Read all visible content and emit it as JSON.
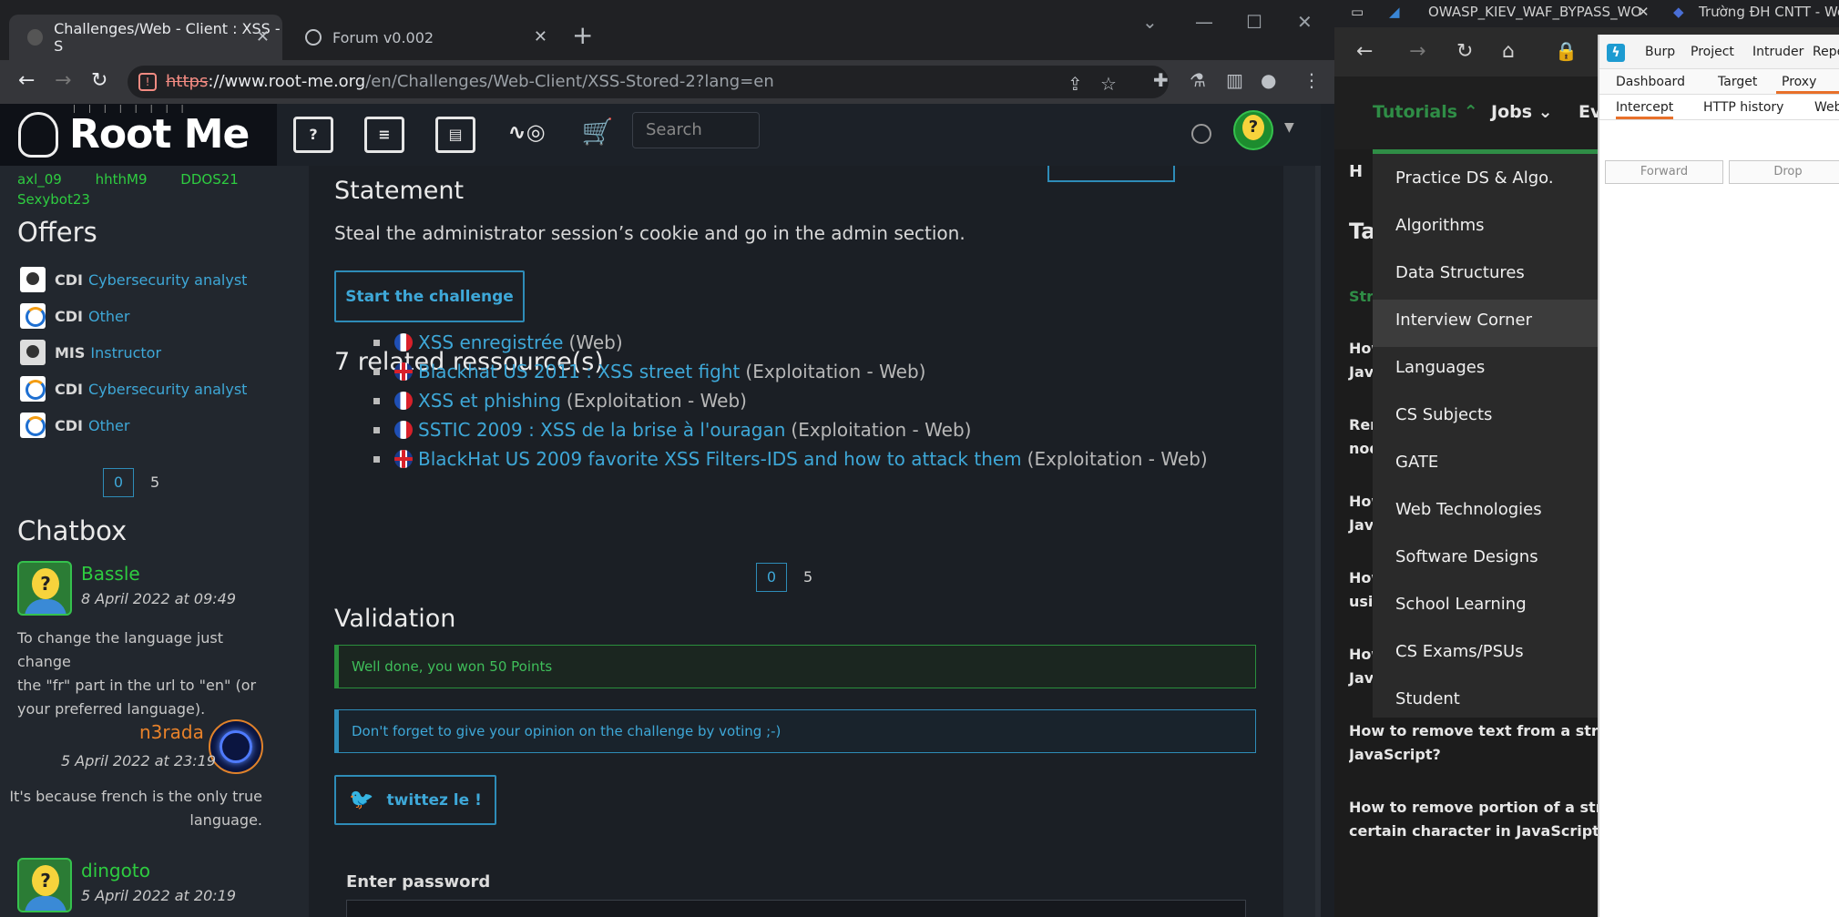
{
  "chrome": {
    "tabs": [
      {
        "title": "Challenges/Web - Client : XSS - S"
      },
      {
        "title": "Forum v0.002"
      }
    ],
    "url": {
      "scheme": "https",
      "host": "://www.root-me.org",
      "path": "/en/Challenges/Web-Client/XSS-Stored-2?lang=en"
    }
  },
  "rootme": {
    "logo": "Root Me",
    "nav_icons": [
      "FAQ",
      "Docs",
      "News",
      "Radar",
      "Shop"
    ],
    "search_placeholder": "Search",
    "sidebar": {
      "top_users": [
        "axl_09",
        "hhthM9",
        "DDOS21",
        "Sexybot23"
      ],
      "offers_title": "Offers",
      "offers": [
        {
          "type": "CDI",
          "role": "Cybersecurity analyst"
        },
        {
          "type": "CDI",
          "role": "Other"
        },
        {
          "type": "MIS",
          "role": "Instructor"
        },
        {
          "type": "CDI",
          "role": "Cybersecurity analyst"
        },
        {
          "type": "CDI",
          "role": "Other"
        }
      ],
      "pager": {
        "current": "0",
        "next": "5"
      },
      "chatbox_title": "Chatbox",
      "chat": [
        {
          "name": "Bassle",
          "date": "8 April 2022 at 09:49",
          "msg1": "To change the language just change",
          "msg2": "the \"fr\" part in the url to \"en\" (or",
          "msg3": "your preferred language)."
        },
        {
          "name": "n3rada",
          "date": "5 April 2022 at 23:19",
          "msg1": "It's because french is the only true",
          "msg2": "language."
        },
        {
          "name": "dingoto",
          "date": "5 April 2022 at 20:19"
        }
      ]
    },
    "main": {
      "statement_title": "Statement",
      "statement_text": "Steal the administrator session’s cookie and go in the admin section.",
      "start_button": "Start the challenge",
      "resources_title": "7 related ressource(s)",
      "resources": [
        {
          "title": "XSS enregistrée",
          "cat": "(Web)",
          "flag": "fr"
        },
        {
          "title": "Blackhat US 2011 : XSS street fight",
          "cat": "(Exploitation - Web)",
          "flag": "uk"
        },
        {
          "title": "XSS et phishing",
          "cat": "(Exploitation - Web)",
          "flag": "fr"
        },
        {
          "title": "SSTIC 2009 : XSS de la brise à l'ouragan",
          "cat": "(Exploitation - Web)",
          "flag": "fr"
        },
        {
          "title": "BlackHat US 2009 favorite XSS Filters-IDS and how to attack them",
          "cat": "(Exploitation - Web)",
          "flag": "uk"
        }
      ],
      "pager": {
        "current": "0",
        "next": "5"
      },
      "validation_title": "Validation",
      "success_msg": "Well done, you won 50 Points",
      "info_msg": "Don't forget to give your opinion on the challenge by voting ;-)",
      "tweet_button": "twittez le !",
      "password_label": "Enter password"
    }
  },
  "right_browser": {
    "tabs": [
      "OWASP_KIEV_WAF_BYPASS_WO",
      "Trường ĐH CNTT - Web"
    ],
    "nav": [
      "Tutorials",
      "Jobs",
      "Ev"
    ],
    "dropdown": [
      "Practice DS & Algo.",
      "Algorithms",
      "Data Structures",
      "Interview Corner",
      "Languages",
      "CS Subjects",
      "GATE",
      "Web Technologies",
      "Software Designs",
      "School Learning",
      "CS Exams/PSUs",
      "Student"
    ],
    "stubs": [
      "H",
      "Ta",
      "Stri"
    ],
    "left_fragments": [
      "How",
      "Jav",
      "Ren",
      "nod",
      "How",
      "Jav",
      "How",
      "usin",
      "How",
      "Jav"
    ],
    "article1_l1": "How to remove text from a string in",
    "article1_l2": "JavaScript?",
    "article2_l1": "How to remove portion of a string a",
    "article2_l2": "certain character in JavaScript ?"
  },
  "burp": {
    "menu": [
      "Burp",
      "Project",
      "Intruder",
      "Repe"
    ],
    "tabs": [
      "Dashboard",
      "Target",
      "Proxy"
    ],
    "subtabs": [
      "Intercept",
      "HTTP history",
      "Web"
    ],
    "forward": "Forward",
    "drop": "Drop"
  }
}
